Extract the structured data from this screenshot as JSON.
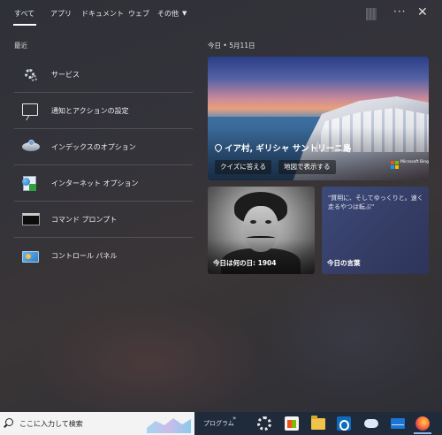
{
  "tabs": {
    "items": [
      "すべて",
      "アプリ",
      "ドキュメント",
      "ウェブ",
      "その他"
    ],
    "active": "すべて"
  },
  "recent": {
    "label": "最近",
    "items": [
      {
        "label": "サービス",
        "icon": "services-gear-icon"
      },
      {
        "label": "通知とアクションの設定",
        "icon": "notification-icon"
      },
      {
        "label": "インデックスのオプション",
        "icon": "indexing-options-icon"
      },
      {
        "label": "インターネット オプション",
        "icon": "internet-options-icon"
      },
      {
        "label": "コマンド プロンプト",
        "icon": "command-prompt-icon"
      },
      {
        "label": "コントロール パネル",
        "icon": "control-panel-icon"
      }
    ]
  },
  "today": {
    "label": "今日",
    "date": "5月11日",
    "hero": {
      "title": "イア村, ギリシャ サントリーニ島",
      "quiz_button": "クイズに答える",
      "map_button": "地図で表示する",
      "brand": "Microsoft Bing"
    },
    "history_card": {
      "caption": "今日は何の日: 1904"
    },
    "quote_card": {
      "quote": "\"質明に、そしてゆっくりと。速く走るやつは転ぶ\"",
      "caption": "今日の言葉"
    }
  },
  "taskbar": {
    "search_placeholder": "ここに入力して検索",
    "programs_label": "プログラム",
    "apps": [
      "settings-icon",
      "store-icon",
      "file-explorer-icon",
      "outlook-icon",
      "onedrive-icon",
      "mail-icon",
      "firefox-icon"
    ]
  }
}
